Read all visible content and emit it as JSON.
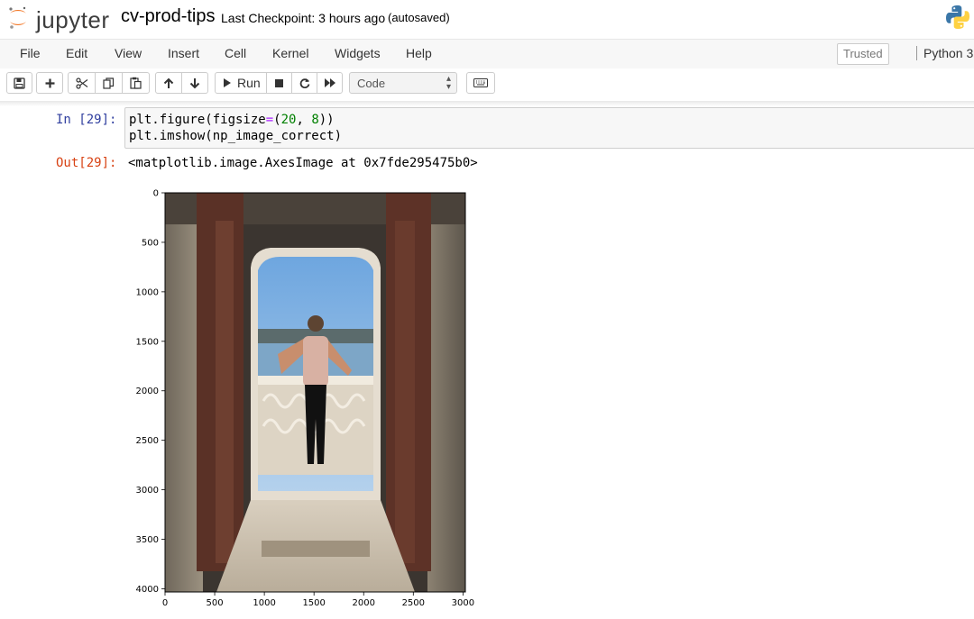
{
  "header": {
    "logo_text": "jupyter",
    "notebook_name": "cv-prod-tips",
    "checkpoint": "Last Checkpoint: 3 hours ago",
    "autosave": "(autosaved)"
  },
  "menubar": {
    "items": [
      "File",
      "Edit",
      "View",
      "Insert",
      "Cell",
      "Kernel",
      "Widgets",
      "Help"
    ],
    "trusted": "Trusted",
    "kernel": "Python 3"
  },
  "toolbar": {
    "run_label": "Run",
    "cell_type": "Code",
    "icons": [
      "save-icon",
      "plus-icon",
      "cut-icon",
      "copy-icon",
      "paste-icon",
      "arrow-up-icon",
      "arrow-down-icon",
      "run-icon",
      "stop-icon",
      "restart-icon",
      "fast-forward-icon",
      "keyboard-icon"
    ]
  },
  "cell": {
    "in_prompt": "In [29]:",
    "code_lines": [
      "plt.figure(figsize=(20, 8))",
      "plt.imshow(np_image_correct)"
    ],
    "out_prompt": "Out[29]:",
    "output_text": "<matplotlib.image.AxesImage at 0x7fde295475b0>"
  },
  "chart_data": {
    "type": "image",
    "xlim": [
      0,
      3024
    ],
    "ylim": [
      4032,
      0
    ],
    "xticks": [
      0,
      500,
      1000,
      1500,
      2000,
      2500,
      3000
    ],
    "yticks": [
      0,
      500,
      1000,
      1500,
      2000,
      2500,
      3000,
      3500,
      4000
    ],
    "xlabel": "",
    "ylabel": "",
    "title": ""
  },
  "colors": {
    "in_prompt": "#303f9f",
    "out_prompt": "#d84315",
    "menubar_bg": "#f7f7f7",
    "code_bg": "#f7f7f7"
  }
}
